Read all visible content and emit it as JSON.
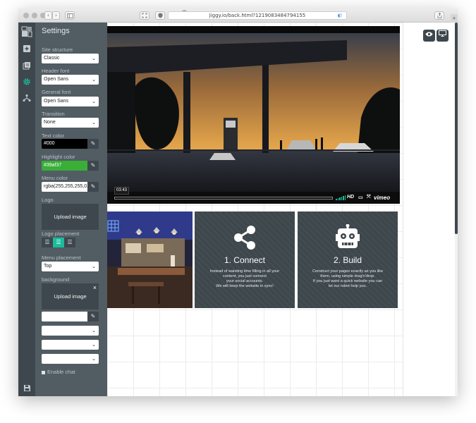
{
  "browser": {
    "url": "jiggy.io/back.html?1219083484794155",
    "tab_badge": "0",
    "nav_back": "‹",
    "nav_forward": "›",
    "new_tab": "+"
  },
  "settings": {
    "title": "Settings",
    "site_structure": {
      "label": "Site structure",
      "value": "Classic"
    },
    "header_font": {
      "label": "Header font",
      "value": "Open Sans"
    },
    "general_font": {
      "label": "General font",
      "value": "Open Sans"
    },
    "transition": {
      "label": "Transition",
      "value": "None"
    },
    "text_color": {
      "label": "Text color",
      "value": "#000"
    },
    "highlight_color": {
      "label": "Highlight color",
      "value": "#39af37"
    },
    "menu_color": {
      "label": "Menu color",
      "value": "rgba(255,255,255,0.5)"
    },
    "logo": {
      "label": "Logo",
      "button": "Upload image"
    },
    "logo_placement": {
      "label": "Logo placement",
      "selected": "center"
    },
    "menu_placement": {
      "label": "Menu placement",
      "value": "Top"
    },
    "background": {
      "label": "background",
      "button": "Upload image",
      "close": "×",
      "color_value": "",
      "select_1": "",
      "select_2": "",
      "select_3": ""
    },
    "enable_chat": {
      "label": "Enable chat",
      "checked": true
    }
  },
  "video": {
    "time": "03:43",
    "hd": "HD",
    "provider": "vimeo"
  },
  "tiles": [
    {
      "title": "1. Connect",
      "icon": "share-icon",
      "lines": [
        "Instead of waisting time filling in all your",
        "content, you just connect",
        "your social accounts.",
        "We will keep the website in sync!"
      ]
    },
    {
      "title": "2. Build",
      "icon": "robot-icon",
      "lines": [
        "Construct your pages exactly as you like",
        "them, using simple drag'n'drop.",
        "If you just want a quick website you can",
        "let our robot help you."
      ]
    }
  ],
  "colors": {
    "accent": "#1abc9c",
    "panel": "#515c63",
    "iconbar": "#3e474d",
    "highlight": "#39af37"
  }
}
